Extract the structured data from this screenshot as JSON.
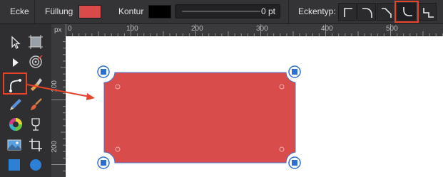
{
  "toolbar": {
    "context_label": "Ecke",
    "fill_label": "Füllung",
    "fill_color": "#db4a4a",
    "stroke_label": "Kontur",
    "stroke_color": "#000000",
    "stroke_width_value": "0 pt",
    "corner_type_label": "Eckentyp:",
    "corner_types": [
      {
        "icon": "corner-square-icon",
        "selected": false
      },
      {
        "icon": "corner-rounded-icon",
        "selected": false
      },
      {
        "icon": "corner-straight-icon",
        "selected": false
      },
      {
        "icon": "corner-concave-icon",
        "selected": true
      },
      {
        "icon": "corner-stepped-icon",
        "selected": false
      }
    ]
  },
  "tools": [
    {
      "icon": "move-tool-icon"
    },
    {
      "icon": "artboard-tool-icon"
    },
    {
      "icon": "node-tool-icon"
    },
    {
      "icon": "point-transform-tool-icon"
    },
    {
      "icon": "corner-tool-icon",
      "selected": true
    },
    {
      "icon": "pen-tool-icon"
    },
    {
      "icon": "pencil-tool-icon"
    },
    {
      "icon": "vector-brush-tool-icon"
    },
    {
      "icon": "color-picker-tool-icon"
    },
    {
      "icon": "fill-tool-icon"
    },
    {
      "icon": "place-image-tool-icon"
    },
    {
      "icon": "crop-tool-icon"
    },
    {
      "icon": "rectangle-tool-icon"
    },
    {
      "icon": "ellipse-tool-icon"
    }
  ],
  "ruler": {
    "unit": "px",
    "top_labels": [
      "0",
      "100",
      "200",
      "300",
      "400",
      "500"
    ],
    "left_labels": [
      "100",
      "200"
    ]
  },
  "canvas": {
    "shape_fill": "#d94c4c",
    "shape_stroke": "#4a78d0",
    "selection_color": "#2e6fd6"
  },
  "colors": {
    "highlight": "#e6432a"
  }
}
